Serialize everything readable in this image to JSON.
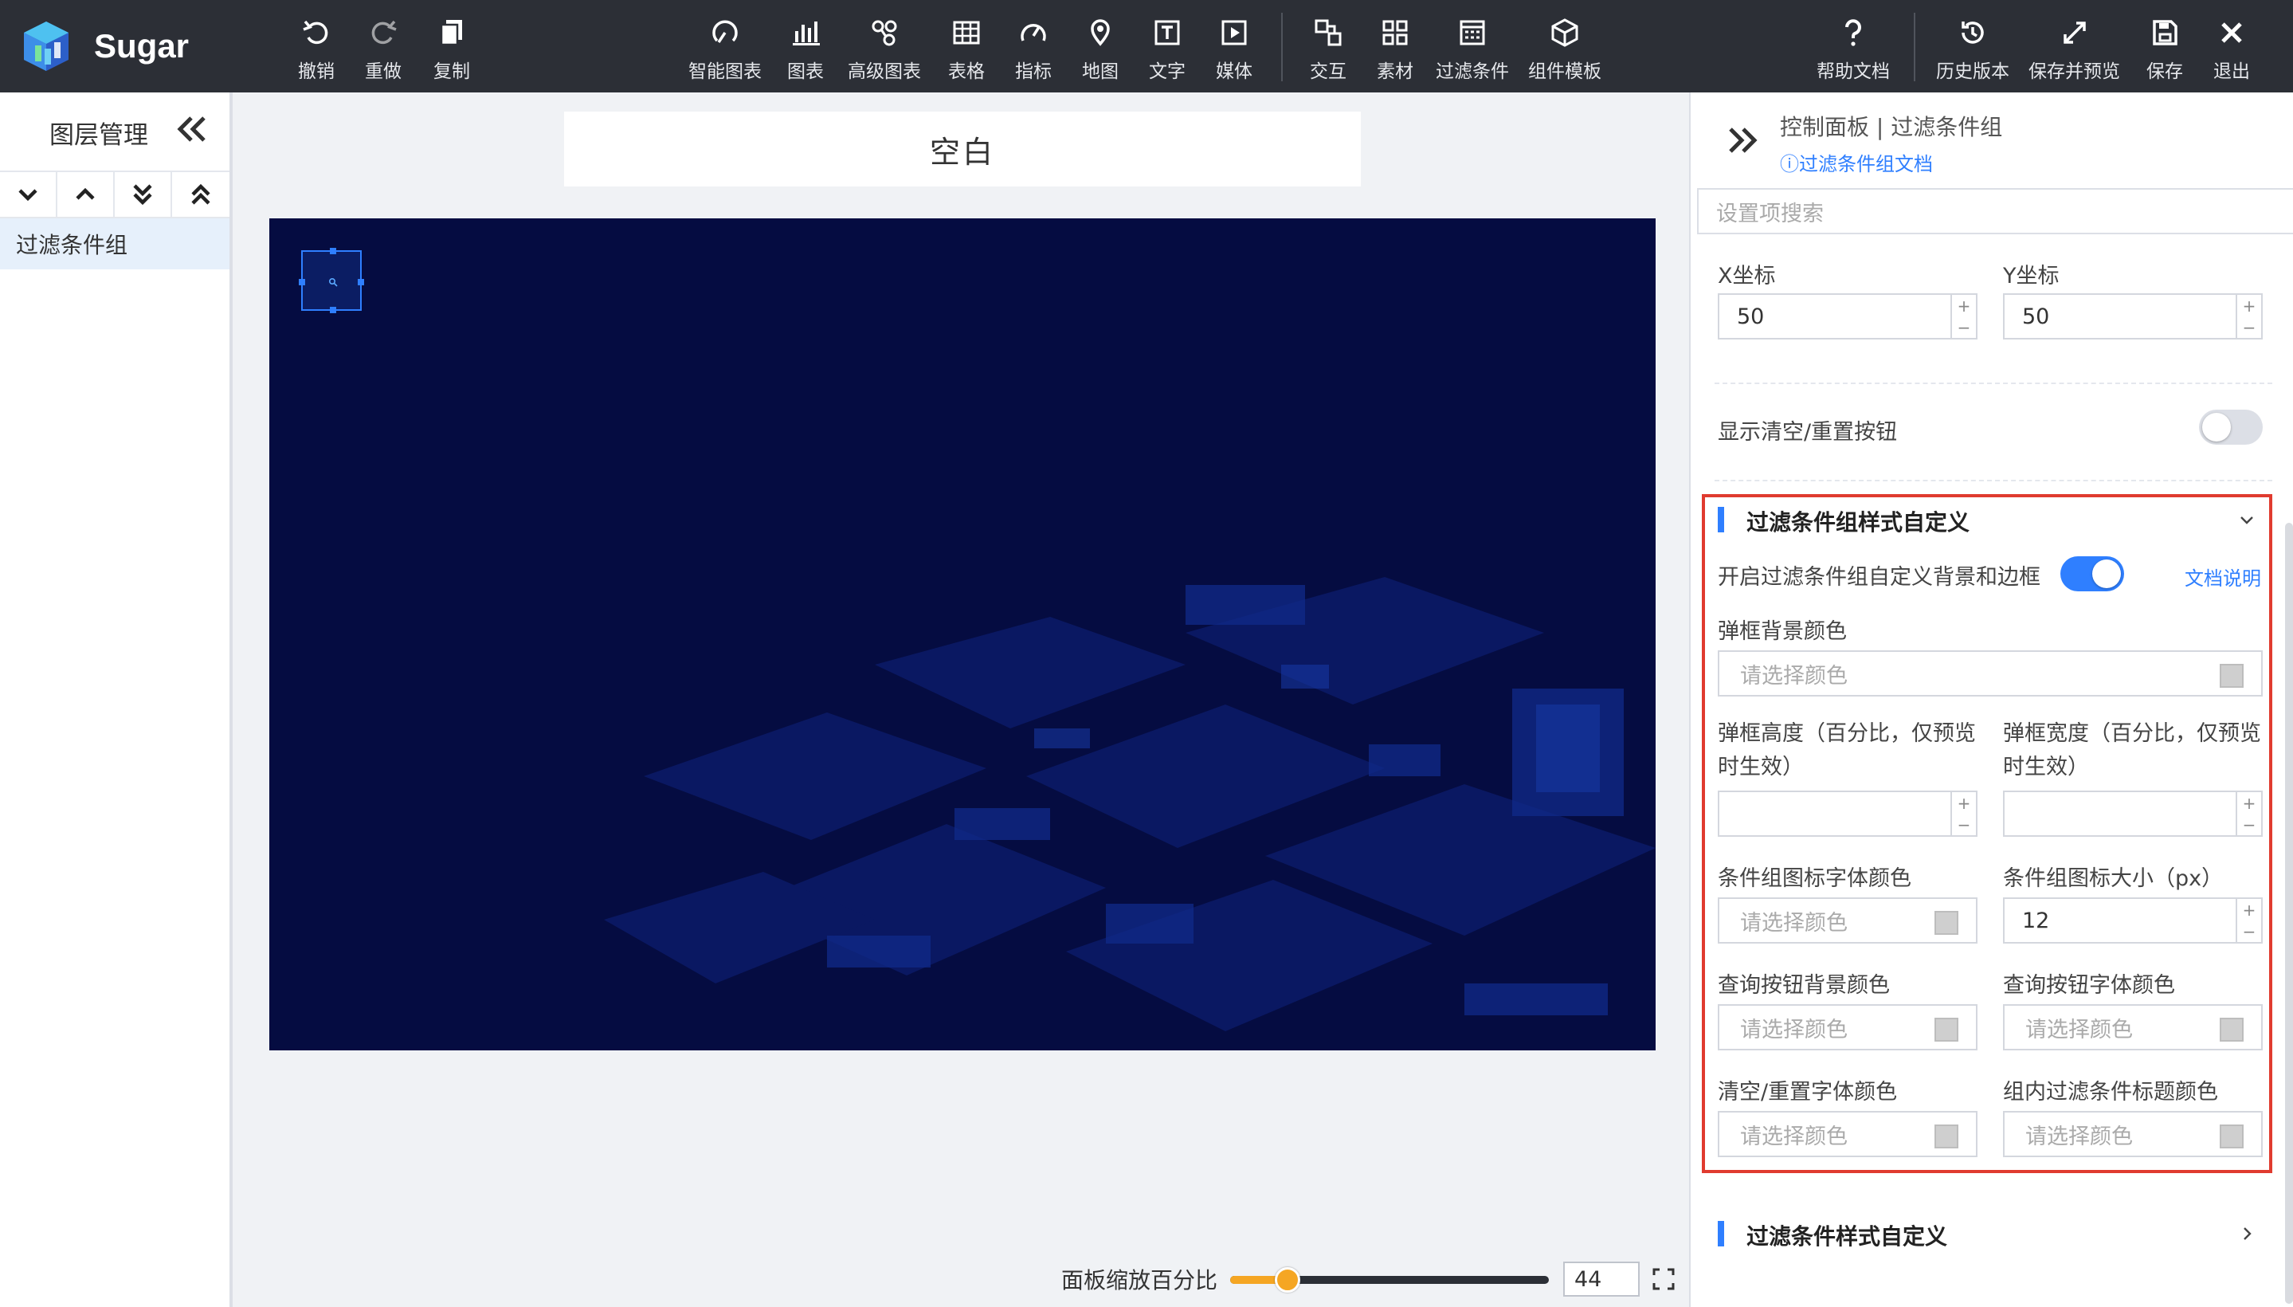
{
  "app": {
    "name": "Sugar",
    "brand_color": "#2f7fff"
  },
  "toolbar": {
    "left": [
      {
        "label": "撤销",
        "icon": "undo-icon"
      },
      {
        "label": "重做",
        "icon": "redo-icon"
      },
      {
        "label": "复制",
        "icon": "copy-icon"
      }
    ],
    "center": [
      {
        "label": "智能图表",
        "icon": "smart-chart-icon"
      },
      {
        "label": "图表",
        "icon": "bar-chart-icon"
      },
      {
        "label": "高级图表",
        "icon": "advanced-chart-icon"
      },
      {
        "label": "表格",
        "icon": "table-icon"
      },
      {
        "label": "指标",
        "icon": "gauge-icon"
      },
      {
        "label": "地图",
        "icon": "map-pin-icon"
      },
      {
        "label": "文字",
        "icon": "text-icon"
      },
      {
        "label": "媒体",
        "icon": "media-icon"
      },
      {
        "label": "交互",
        "icon": "interaction-icon"
      },
      {
        "label": "素材",
        "icon": "grid-icon"
      },
      {
        "label": "过滤条件",
        "icon": "filter-icon"
      },
      {
        "label": "组件模板",
        "icon": "template-icon"
      }
    ],
    "right": [
      {
        "label": "帮助文档",
        "icon": "help-icon"
      },
      {
        "label": "历史版本",
        "icon": "history-icon"
      },
      {
        "label": "保存并预览",
        "icon": "expand-icon"
      },
      {
        "label": "保存",
        "icon": "save-icon"
      },
      {
        "label": "退出",
        "icon": "close-icon"
      }
    ]
  },
  "layers": {
    "title": "图层管理",
    "items": [
      {
        "label": "过滤条件组",
        "selected": true
      }
    ]
  },
  "canvas": {
    "title": "空白",
    "background": "#050c41",
    "zoom": {
      "label": "面板缩放百分比",
      "value": "44",
      "percent": 44
    }
  },
  "panel": {
    "breadcrumb": "控制面板 | 过滤条件组",
    "doc_link": "过滤条件组文档",
    "search_placeholder": "设置项搜索",
    "x_label": "X坐标",
    "x_value": "50",
    "y_label": "Y坐标",
    "y_value": "50",
    "reset_label": "显示清空/重置按钮",
    "reset_enabled": false,
    "section1": {
      "title": "过滤条件组样式自定义",
      "enable_label": "开启过滤条件组自定义背景和边框",
      "enable_on": true,
      "doc_link": "文档说明",
      "bg_label": "弹框背景颜色",
      "color_placeholder": "请选择颜色",
      "height_label": "弹框高度（百分比，仅预览时生效）",
      "width_label": "弹框宽度（百分比，仅预览时生效）",
      "height_value": "",
      "width_value": "",
      "icon_font_label": "条件组图标字体颜色",
      "icon_size_label": "条件组图标大小（px）",
      "icon_size_value": "12",
      "query_bg_label": "查询按钮背景颜色",
      "query_font_label": "查询按钮字体颜色",
      "reset_font_label": "清空/重置字体颜色",
      "title_color_label": "组内过滤条件标题颜色"
    },
    "section2": {
      "title": "过滤条件样式自定义"
    },
    "stepper_plus": "+",
    "stepper_minus": "−"
  }
}
